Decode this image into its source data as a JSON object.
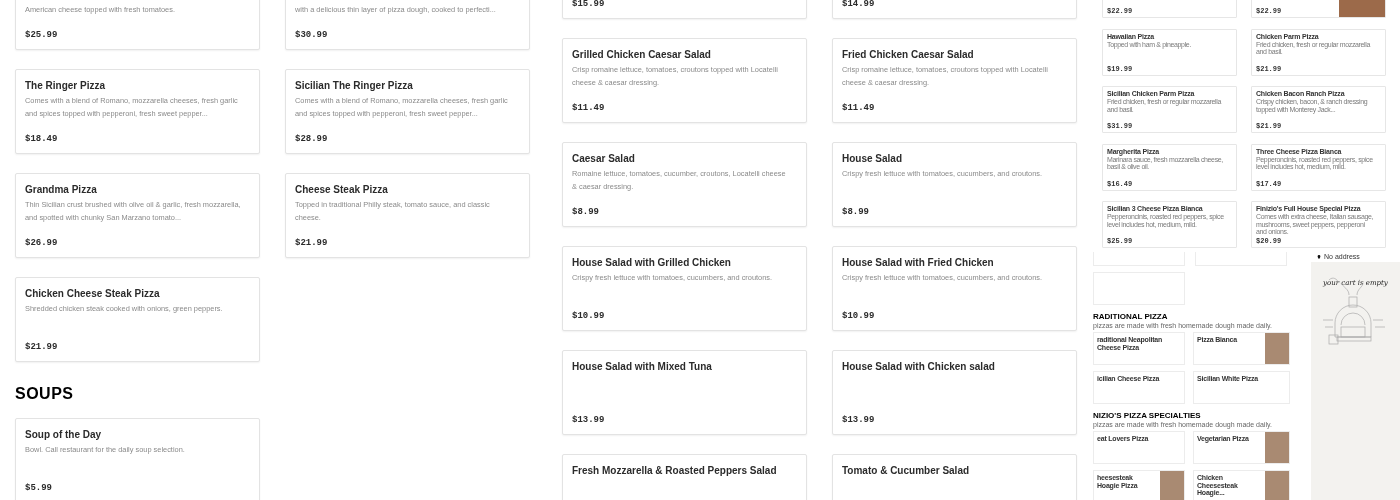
{
  "pizza_menu": {
    "items": [
      {
        "description": "American cheese topped with fresh tomatoes.",
        "price": "$25.99"
      },
      {
        "description": "with a delicious thin layer of pizza dough, cooked to perfecti...",
        "price": "$30.99"
      },
      {
        "title": "The Ringer Pizza",
        "description": "Comes with a blend of Romano, mozzarella cheeses, fresh garlic and spices topped with pepperoni, fresh sweet pepper...",
        "price": "$18.49"
      },
      {
        "title": "Sicilian The Ringer Pizza",
        "description": "Comes with a blend of Romano, mozzarella cheeses, fresh garlic and spices topped with pepperoni, fresh sweet pepper...",
        "price": "$28.99"
      },
      {
        "title": "Grandma Pizza",
        "description": "Thin Sicilian crust brushed with olive oil & garlic, fresh mozzarella, and spotted with chunky San Marzano tomato...",
        "price": "$26.99"
      },
      {
        "title": "Cheese Steak Pizza",
        "description": "Topped in traditional Philly steak, tomato sauce, and classic cheese.",
        "price": "$21.99"
      },
      {
        "title": "Chicken Cheese Steak Pizza",
        "description": "Shredded chicken steak cooked with onions, green peppers.",
        "price": "$21.99"
      }
    ],
    "soups": {
      "heading": "SOUPS",
      "items": [
        {
          "title": "Soup of the Day",
          "description": "Bowl. Call restaurant for the daily soup selection.",
          "price": "$5.99"
        }
      ]
    }
  },
  "salad_menu": {
    "items": [
      {
        "price": "$15.99"
      },
      {
        "price": "$14.99"
      },
      {
        "title": "Grilled Chicken Caesar Salad",
        "description": "Crisp romaine lettuce, tomatoes, croutons topped with Locatelli cheese & caesar dressing.",
        "price": "$11.49"
      },
      {
        "title": "Fried Chicken Caesar Salad",
        "description": "Crisp romaine lettuce, tomatoes, croutons topped with Locatelli cheese & caesar dressing.",
        "price": "$11.49"
      },
      {
        "title": "Caesar Salad",
        "description": "Romaine lettuce, tomatoes, cucumber, croutons, Locatelli cheese & caesar dressing.",
        "price": "$8.99"
      },
      {
        "title": "House Salad",
        "description": "Crispy fresh lettuce with tomatoes, cucumbers, and croutons.",
        "price": "$8.99"
      },
      {
        "title": "House Salad with Grilled Chicken",
        "description": "Crispy fresh lettuce with tomatoes, cucumbers, and croutons.",
        "price": "$10.99"
      },
      {
        "title": "House Salad with Fried Chicken",
        "description": "Crispy fresh lettuce with tomatoes, cucumbers, and croutons.",
        "price": "$10.99"
      },
      {
        "title": "House Salad with Mixed Tuna",
        "price": "$13.99"
      },
      {
        "title": "House Salad with Chicken salad",
        "price": "$13.99"
      },
      {
        "title": "Fresh Mozzarella & Roasted Peppers Salad"
      },
      {
        "title": "Tomato & Cucumber Salad"
      }
    ]
  },
  "thumbnail_menu": {
    "items": [
      {
        "price": "$22.99",
        "photo": false
      },
      {
        "price": "$22.99",
        "photo": true
      },
      {
        "title": "Hawaiian Pizza",
        "description": "Topped with ham & pineapple.",
        "price": "$19.99",
        "photo": false
      },
      {
        "title": "Chicken Parm Pizza",
        "description": "Fried chicken, fresh or regular mozzarella and basil.",
        "price": "$21.99",
        "photo": false
      },
      {
        "title": "Sicilian Chicken Parm Pizza",
        "description": "Fried chicken, fresh or regular mozzarella and basil.",
        "price": "$31.99",
        "photo": false
      },
      {
        "title": "Chicken Bacon Ranch Pizza",
        "description": "Crispy chicken, bacon, & ranch dressing topped with Monterey Jack...",
        "price": "$21.99",
        "photo": false
      },
      {
        "title": "Margherita Pizza",
        "description": "Marinara sauce, fresh mozzarella cheese, basil & olive oil.",
        "price": "$16.49",
        "photo": false
      },
      {
        "title": "Three Cheese Pizza Bianca",
        "description": "Pepperoncinis, roasted red peppers, spice level includes hot, medium, mild.",
        "price": "$17.49",
        "photo": false
      },
      {
        "title": "Sicilian 3 Cheese Pizza Bianca",
        "description": "Pepperoncinis, roasted red peppers, spice level includes hot, medium, mild.",
        "price": "$25.99",
        "photo": false
      },
      {
        "title": "Finizio's Full House Special Pizza",
        "description": "Comes with extra cheese, Italian sausage, mushrooms, sweet peppers, pepperoni and onions.",
        "price": "$20.99",
        "photo": false
      }
    ]
  },
  "mini_menu": {
    "sections": [
      {
        "heading": "RADITIONAL PIZZA",
        "subtitle": "pizzas are made with fresh homemade dough made daily.",
        "items": [
          {
            "title": "raditional Neapolitan Cheese Pizza",
            "photo": false
          },
          {
            "title": "Pizza Bianca",
            "photo": true
          },
          {
            "title": "icilian Cheese Pizza",
            "photo": false
          },
          {
            "title": "Sicilian White Pizza",
            "photo": false
          }
        ]
      },
      {
        "heading": "NIZIO'S PIZZA SPECIALTIES",
        "subtitle": "pizzas are made with fresh homemade dough made daily.",
        "items": [
          {
            "title": "eat Lovers Pizza",
            "photo": false
          },
          {
            "title": "Vegetarian Pizza",
            "photo": true
          },
          {
            "title": "heesesteak Hoagie Pizza",
            "photo": true
          },
          {
            "title": "Chicken Cheesesteak Hoagie...",
            "photo": true
          }
        ]
      }
    ]
  },
  "cart": {
    "address": "No address",
    "empty_message": "your cart is empty"
  }
}
